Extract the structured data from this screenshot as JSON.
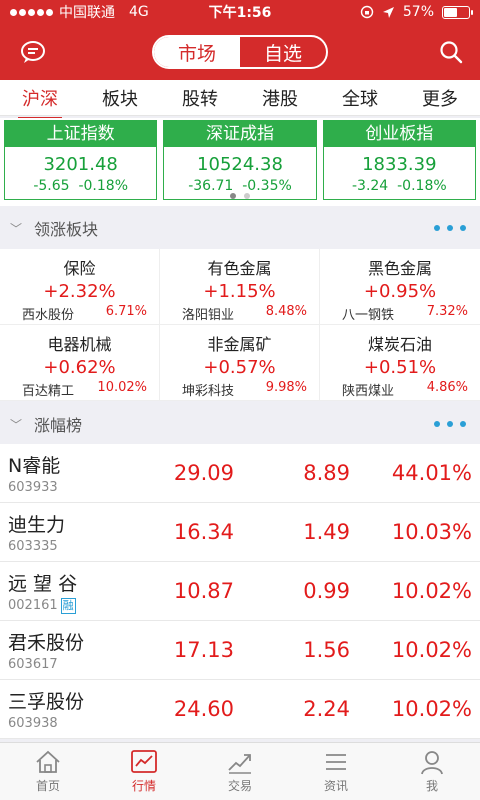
{
  "status": {
    "carrier": "中国联通",
    "network": "4G",
    "time": "下午1:56",
    "battery": "57%",
    "battery_level": 0.57
  },
  "header": {
    "segment_market": "市场",
    "segment_watchlist": "自选"
  },
  "tabs": [
    "沪深",
    "板块",
    "股转",
    "港股",
    "全球",
    "更多"
  ],
  "indices": [
    {
      "name": "上证指数",
      "value": "3201.48",
      "change": "-5.65",
      "pct": "-0.18%"
    },
    {
      "name": "深证成指",
      "value": "10524.38",
      "change": "-36.71",
      "pct": "-0.35%"
    },
    {
      "name": "创业板指",
      "value": "1833.39",
      "change": "-3.24",
      "pct": "-0.18%"
    }
  ],
  "sections": {
    "sectors_title": "领涨板块",
    "gainers_title": "涨幅榜"
  },
  "sectors": [
    {
      "name": "保险",
      "pct": "+2.32%",
      "lead": "西水股份",
      "lead_pct": "6.71%"
    },
    {
      "name": "有色金属",
      "pct": "+1.15%",
      "lead": "洛阳钼业",
      "lead_pct": "8.48%"
    },
    {
      "name": "黑色金属",
      "pct": "+0.95%",
      "lead": "八一钢铁",
      "lead_pct": "7.32%"
    },
    {
      "name": "电器机械",
      "pct": "+0.62%",
      "lead": "百达精工",
      "lead_pct": "10.02%"
    },
    {
      "name": "非金属矿",
      "pct": "+0.57%",
      "lead": "坤彩科技",
      "lead_pct": "9.98%"
    },
    {
      "name": "煤炭石油",
      "pct": "+0.51%",
      "lead": "陕西煤业",
      "lead_pct": "4.86%"
    }
  ],
  "gainers": [
    {
      "name": "N睿能",
      "code": "603933",
      "badge": "",
      "price": "29.09",
      "change": "8.89",
      "pct": "44.01%"
    },
    {
      "name": "迪生力",
      "code": "603335",
      "badge": "",
      "price": "16.34",
      "change": "1.49",
      "pct": "10.03%"
    },
    {
      "name": "远 望 谷",
      "code": "002161",
      "badge": "融",
      "price": "10.87",
      "change": "0.99",
      "pct": "10.02%"
    },
    {
      "name": "君禾股份",
      "code": "603617",
      "badge": "",
      "price": "17.13",
      "change": "1.56",
      "pct": "10.02%"
    },
    {
      "name": "三孚股份",
      "code": "603938",
      "badge": "",
      "price": "24.60",
      "change": "2.24",
      "pct": "10.02%"
    }
  ],
  "nav": [
    "首页",
    "行情",
    "交易",
    "资讯",
    "我"
  ],
  "colors": {
    "brand": "#d42b2b",
    "up": "#e21b1b",
    "down": "#17a03a",
    "accent": "#2a9fd6"
  }
}
